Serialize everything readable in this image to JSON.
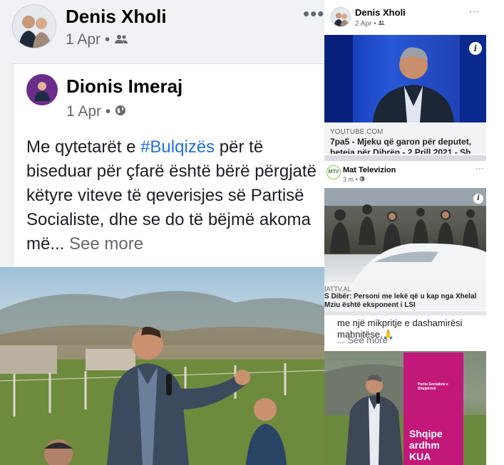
{
  "left_post": {
    "author": "Denis Xholi",
    "date": "1 Apr",
    "audience_icon": "friends-icon",
    "more": "•••",
    "shared": {
      "author": "Dionis Imeraj",
      "date": "1 Apr",
      "audience_icon": "globe-icon",
      "text_before": "Me qytetarët e ",
      "hashtag": "#Bulqizës",
      "text_after": " për të biseduar për çfarë është bërë përgjatë këtyre viteve të qeverisjes së Partisë Socialiste, dhe se do të bëjmë akoma më... ",
      "see_more": "See more"
    }
  },
  "right_post": {
    "author": "Denis Xholi",
    "date": "2 Apr",
    "audience_icon": "friends-icon",
    "more": "···",
    "youtube_card": {
      "domain": "YOUTUBE.COM",
      "title": "7pa5 - Mjeku që garon për deputet, beteja për Dibrën - 2 Prill 2021 - Sh..."
    },
    "mat_post": {
      "logo_text": "MTV",
      "author": "Mat Televizion",
      "date": "3 m",
      "audience_icon": "globe-icon",
      "more": "···",
      "card": {
        "domain": "IATTV.AL",
        "title": "S Dibër: Personi me lekë që u kap nga Xhelal Mziu është eksponent i LSI"
      }
    },
    "cut_text": "me një mikpritje e dashamirësi mahnitëse.🙏",
    "see_more": "... See more",
    "banner_logo": "Partia Socialiste e Shqipërisë",
    "banner_text": "Shqipe\nardhm\nKUA"
  },
  "colors": {
    "hashtag": "#216fdb",
    "meta": "#65676b",
    "banner": "#c2187a"
  }
}
